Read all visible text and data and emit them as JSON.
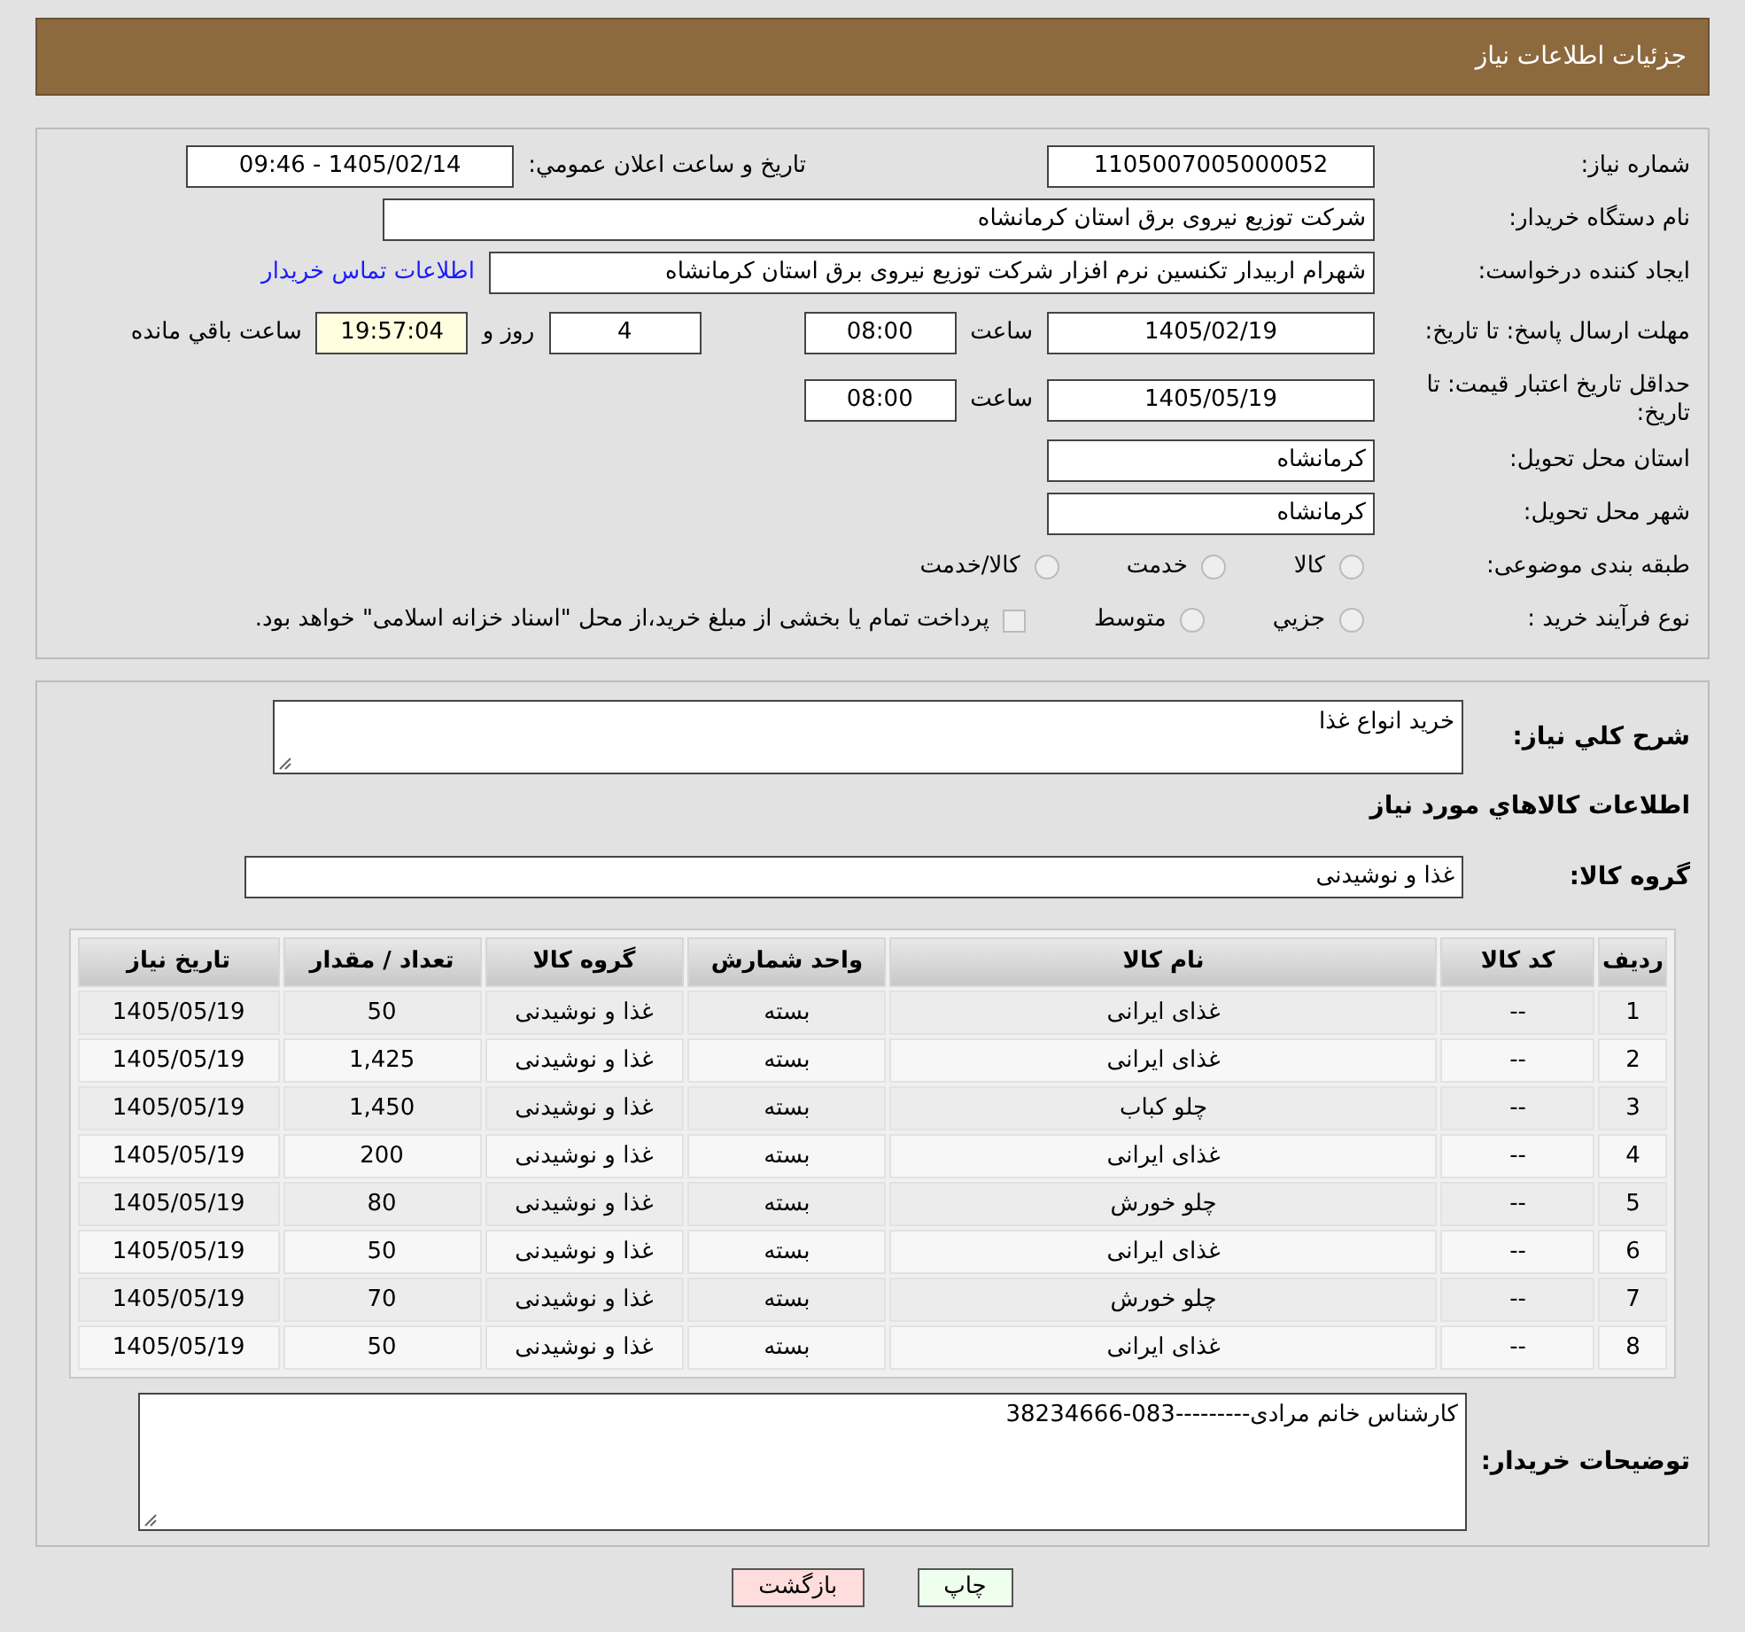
{
  "header": {
    "title": "جزئیات اطلاعات نیاز"
  },
  "form": {
    "need_number": {
      "label": "شماره نیاز:",
      "value": "1105007005000052"
    },
    "announce": {
      "label": "تاريخ و ساعت اعلان عمومي:",
      "value": "1405/02/14 - 09:46"
    },
    "buyer_org": {
      "label": "نام دستگاه خریدار:",
      "value": "شرکت توزیع نیروی برق استان کرمانشاه"
    },
    "requester": {
      "label": "ایجاد کننده درخواست:",
      "value": "شهرام اربیدار تکنسین نرم افزار شرکت توزیع نیروی برق استان کرمانشاه",
      "link": "اطلاعات تماس خریدار"
    },
    "deadline": {
      "label": "مهلت ارسال پاسخ: تا تاریخ:",
      "date": "1405/02/19",
      "time_label": "ساعت",
      "time": "08:00",
      "days": "4",
      "days_label": "روز و",
      "remaining": "19:57:04",
      "remaining_label": "ساعت باقي مانده"
    },
    "validity": {
      "label": "حداقل تاریخ اعتبار قیمت: تا تاریخ:",
      "date": "1405/05/19",
      "time_label": "ساعت",
      "time": "08:00"
    },
    "province": {
      "label": "استان محل تحویل:",
      "value": "کرمانشاه"
    },
    "city": {
      "label": "شهر محل تحویل:",
      "value": "کرمانشاه"
    },
    "category": {
      "label": "طبقه بندی موضوعی:",
      "options": [
        {
          "label": "کالا",
          "selected": false
        },
        {
          "label": "خدمت",
          "selected": false
        },
        {
          "label": "کالا/خدمت",
          "selected": false
        }
      ]
    },
    "process": {
      "label": "نوع فرآیند خرید :",
      "options": [
        {
          "label": "جزيي",
          "selected": false
        },
        {
          "label": "متوسط",
          "selected": false
        }
      ],
      "payment": {
        "checked": false,
        "text": "پرداخت تمام یا بخشی از مبلغ خرید،از محل \"اسناد خزانه اسلامی\" خواهد بود."
      }
    }
  },
  "details": {
    "description": {
      "label": "شرح كلي نياز:",
      "value": "خرید انواع غذا"
    },
    "section_title": "اطلاعات كالاهاي مورد نياز",
    "group": {
      "label": "گروه کالا:",
      "value": "غذا و نوشیدنی"
    },
    "table": {
      "columns": [
        "رديف",
        "کد کالا",
        "نام کالا",
        "واحد شمارش",
        "گروه کالا",
        "تعداد / مقدار",
        "تاریخ نیاز"
      ],
      "rows": [
        [
          "1",
          "--",
          "غذای ایرانی",
          "بسته",
          "غذا و نوشیدنی",
          "50",
          "1405/05/19"
        ],
        [
          "2",
          "--",
          "غذای ایرانی",
          "بسته",
          "غذا و نوشیدنی",
          "1,425",
          "1405/05/19"
        ],
        [
          "3",
          "--",
          "چلو کباب",
          "بسته",
          "غذا و نوشیدنی",
          "1,450",
          "1405/05/19"
        ],
        [
          "4",
          "--",
          "غذای ایرانی",
          "بسته",
          "غذا و نوشیدنی",
          "200",
          "1405/05/19"
        ],
        [
          "5",
          "--",
          "چلو خورش",
          "بسته",
          "غذا و نوشیدنی",
          "80",
          "1405/05/19"
        ],
        [
          "6",
          "--",
          "غذای ایرانی",
          "بسته",
          "غذا و نوشیدنی",
          "50",
          "1405/05/19"
        ],
        [
          "7",
          "--",
          "چلو خورش",
          "بسته",
          "غذا و نوشیدنی",
          "70",
          "1405/05/19"
        ],
        [
          "8",
          "--",
          "غذای ایرانی",
          "بسته",
          "غذا و نوشیدنی",
          "50",
          "1405/05/19"
        ]
      ]
    },
    "notes": {
      "label": "توضیحات خریدار:",
      "value": "کارشناس خانم مرادی---------083-38234666"
    }
  },
  "buttons": [
    {
      "kind": "print",
      "label": "چاپ"
    },
    {
      "kind": "back",
      "label": "بازگشت"
    }
  ]
}
